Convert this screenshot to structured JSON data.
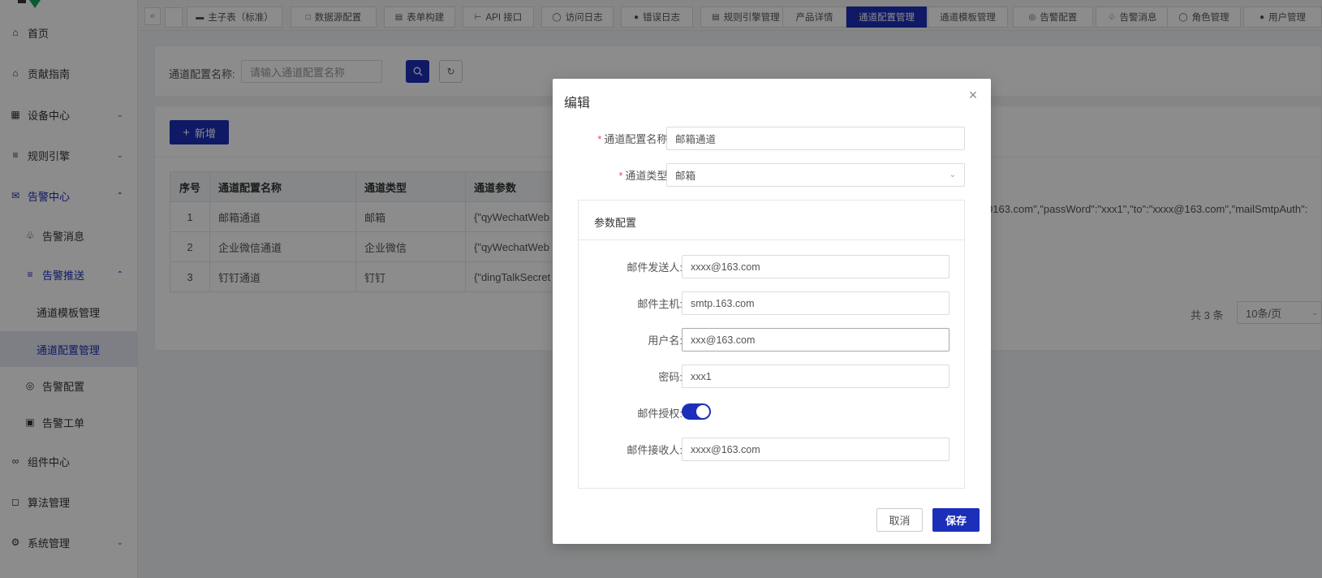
{
  "colors": {
    "accent": "#1c2fb8",
    "required": "#e34d59"
  },
  "sidebar": {
    "items": [
      {
        "label": "首页",
        "icon": "home-icon"
      },
      {
        "label": "贡献指南",
        "icon": "home-icon"
      },
      {
        "label": "设备中心",
        "icon": "grid-icon"
      },
      {
        "label": "规则引擎",
        "icon": "sliders-icon"
      },
      {
        "label": "告警中心",
        "icon": "mail-icon"
      },
      {
        "label": "告警消息",
        "icon": "bell-icon"
      },
      {
        "label": "告警推送",
        "icon": "sliders-icon"
      },
      {
        "label": "通道模板管理"
      },
      {
        "label": "通道配置管理"
      },
      {
        "label": "告警配置",
        "icon": "dribbble-icon"
      },
      {
        "label": "告警工单",
        "icon": "clipboard-icon"
      },
      {
        "label": "组件中心",
        "icon": "paperclip-icon"
      },
      {
        "label": "算法管理",
        "icon": "chip-icon"
      },
      {
        "label": "系统管理",
        "icon": "gear-icon"
      }
    ]
  },
  "tabs": [
    {
      "label": "主子表（标准）",
      "icon": "card-icon"
    },
    {
      "label": "数据源配置",
      "icon": "chat-icon"
    },
    {
      "label": "表单构建",
      "icon": "form-icon"
    },
    {
      "label": "API 接口",
      "icon": "plug-icon"
    },
    {
      "label": "访问日志",
      "icon": "user-icon"
    },
    {
      "label": "错误日志",
      "icon": "error-icon"
    },
    {
      "label": "规则引擎管理",
      "icon": "list-icon"
    },
    {
      "label": "产品详情"
    },
    {
      "label": "通道配置管理"
    },
    {
      "label": "通道模板管理"
    },
    {
      "label": "告警配置",
      "icon": "dribbble-icon"
    },
    {
      "label": "告警消息",
      "icon": "bell-icon"
    },
    {
      "label": "角色管理",
      "icon": "user-icon"
    },
    {
      "label": "用户管理",
      "icon": "user-solid-icon"
    }
  ],
  "search": {
    "label": "通道配置名称:",
    "placeholder": "请输入通道配置名称"
  },
  "toolbar": {
    "add_label": "新增"
  },
  "table": {
    "headers": [
      "序号",
      "通道配置名称",
      "通道类型",
      "通道参数"
    ],
    "rows": [
      [
        "1",
        "邮箱通道",
        "邮箱",
        "{\"qyWechatWeb"
      ],
      [
        "2",
        "企业微信通道",
        "企业微信",
        "{\"qyWechatWeb"
      ],
      [
        "3",
        "钉钉通道",
        "钉钉",
        "{\"dingTalkSecret"
      ]
    ],
    "row1_param_tail": "0163.com\",\"passWord\":\"xxx1\",\"to\":\"xxxx@163.com\",\"mailSmtpAuth\":"
  },
  "pager": {
    "total": "共 3 条",
    "page_size": "10条/页"
  },
  "modal": {
    "title": "编辑",
    "close": "×",
    "fields": {
      "name": {
        "label": "通道配置名称:",
        "value": "邮箱通道"
      },
      "type": {
        "label": "通道类型:",
        "value": "邮箱"
      }
    },
    "param_section_title": "参数配置",
    "params": {
      "sender": {
        "label": "邮件发送人:",
        "value": "xxxx@163.com"
      },
      "host": {
        "label": "邮件主机:",
        "value": "smtp.163.com"
      },
      "username": {
        "label": "用户名:",
        "value": "xxx@163.com"
      },
      "password": {
        "label": "密码:",
        "value": "xxx1"
      },
      "auth": {
        "label": "邮件授权:",
        "value": true
      },
      "receiver": {
        "label": "邮件接收人:",
        "value": "xxxx@163.com"
      }
    },
    "cancel_label": "取消",
    "save_label": "保存"
  }
}
